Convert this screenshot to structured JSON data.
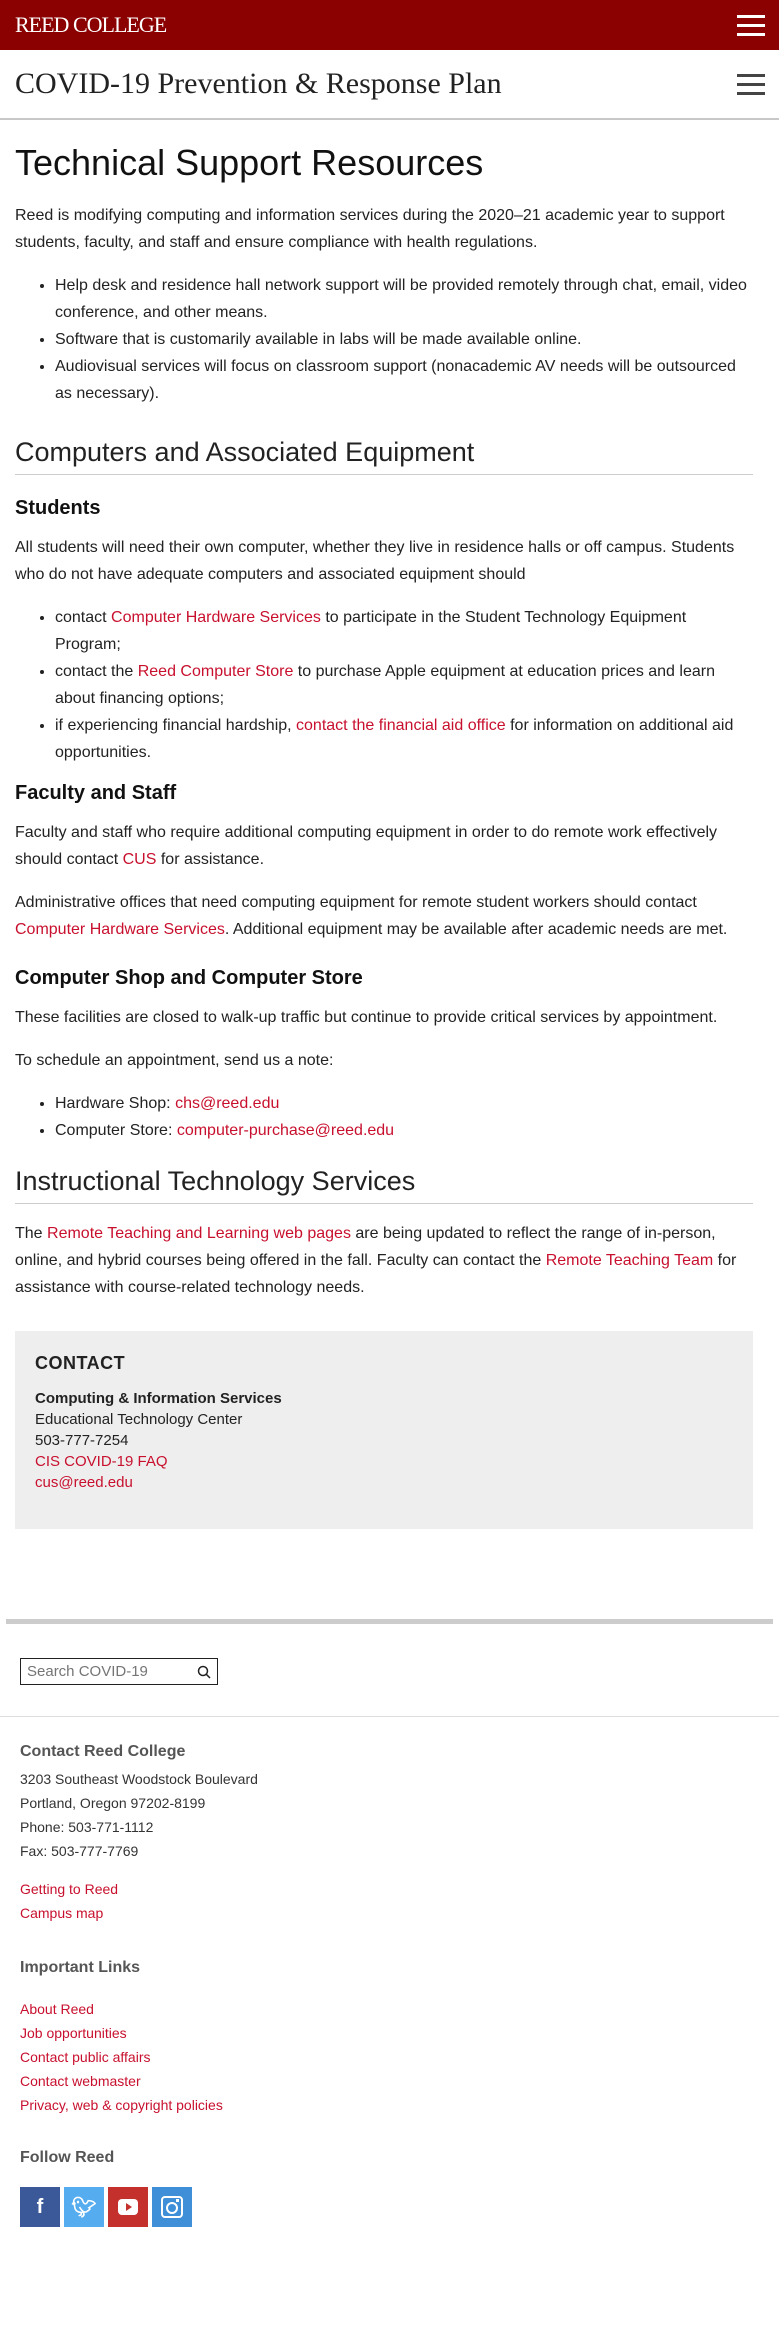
{
  "brand": {
    "logo": "REED COLLEGE",
    "section_title": "COVID-19 Prevention & Response Plan"
  },
  "page": {
    "title": "Technical Support Resources",
    "intro": "Reed is modifying computing and information services during the 2020–21 academic year to support students, faculty, and staff and ensure compliance with health regulations.",
    "bullets": [
      "Help desk and residence hall network support will be provided remotely through chat, email, video conference, and other means.",
      "Software that is customarily available in labs will be made available online.",
      "Audiovisual services will focus on classroom support (nonacademic AV needs will be outsourced as necessary)."
    ],
    "sec1": "Computers and Associated Equipment",
    "students_h": "Students",
    "students_p": "All students will need their own computer, whether they live in residence halls or off campus. Students who do not have adequate computers and associated equipment should",
    "s_b1": {
      "pre": "contact ",
      "link": "Computer Hardware Services",
      "post": " to participate in the Student Technology Equipment Program;"
    },
    "s_b2": {
      "pre": "contact the ",
      "link": "Reed Computer Store",
      "post": " to purchase Apple equipment at education prices and learn about financing options;"
    },
    "s_b3": {
      "pre": "if experiencing financial hardship, ",
      "link": "contact the financial aid office",
      "post": " for information on additional aid opportunities."
    },
    "faculty_h": "Faculty and Staff",
    "faculty_p1": {
      "pre": "Faculty and staff who require additional computing equipment in order to do remote work effectively should contact ",
      "link": "CUS",
      "post": " for assistance."
    },
    "faculty_p2": {
      "pre": "Administrative offices that need computing equipment for remote student workers should contact ",
      "link": "Computer Hardware Services",
      "post": ". Additional equipment may be available after academic needs are met."
    },
    "shop_h": "Computer Shop and Computer Store",
    "shop_p1": "These facilities are closed to walk-up traffic but continue to provide critical services by appointment.",
    "shop_p2": "To schedule an appointment, send us a note:",
    "shop_b1": {
      "pre": "Hardware Shop: ",
      "link": "chs@reed.edu"
    },
    "shop_b2": {
      "pre": "Computer Store: ",
      "link": "computer-purchase@reed.edu"
    },
    "sec2": "Instructional Technology Services",
    "its_p": {
      "pre": "The ",
      "link1": "Remote Teaching and Learning web pages",
      "mid": " are being updated to reflect the range of in-person, online, and hybrid courses being offered in the fall. Faculty can contact the ",
      "link2": "Remote Teaching Team",
      "post": " for assistance with course-related technology needs."
    }
  },
  "contact": {
    "heading": "CONTACT",
    "org": "Computing & Information Services",
    "dept": "Educational Technology Center",
    "phone": "503-777-7254",
    "faq": "CIS COVID-19 FAQ",
    "email": "cus@reed.edu"
  },
  "search": {
    "placeholder": "Search COVID-19"
  },
  "footer": {
    "contact_h": "Contact Reed College",
    "addr1": "3203 Southeast Woodstock Boulevard",
    "addr2": "Portland, Oregon 97202-8199",
    "phone": "Phone: 503-771-1112",
    "fax": "Fax: 503-777-7769",
    "links1": [
      "Getting to Reed",
      "Campus map"
    ],
    "important_h": "Important Links",
    "links2": [
      "About Reed",
      "Job opportunities",
      "Contact public affairs",
      "Contact webmaster",
      "Privacy, web & copyright policies"
    ],
    "follow_h": "Follow Reed"
  },
  "colors": {
    "brand": "#8b0000",
    "link": "#c8102e",
    "facebook": "#3b5998",
    "twitter": "#55acee",
    "youtube": "#c4302b",
    "instagram": "#3f8fd8"
  }
}
